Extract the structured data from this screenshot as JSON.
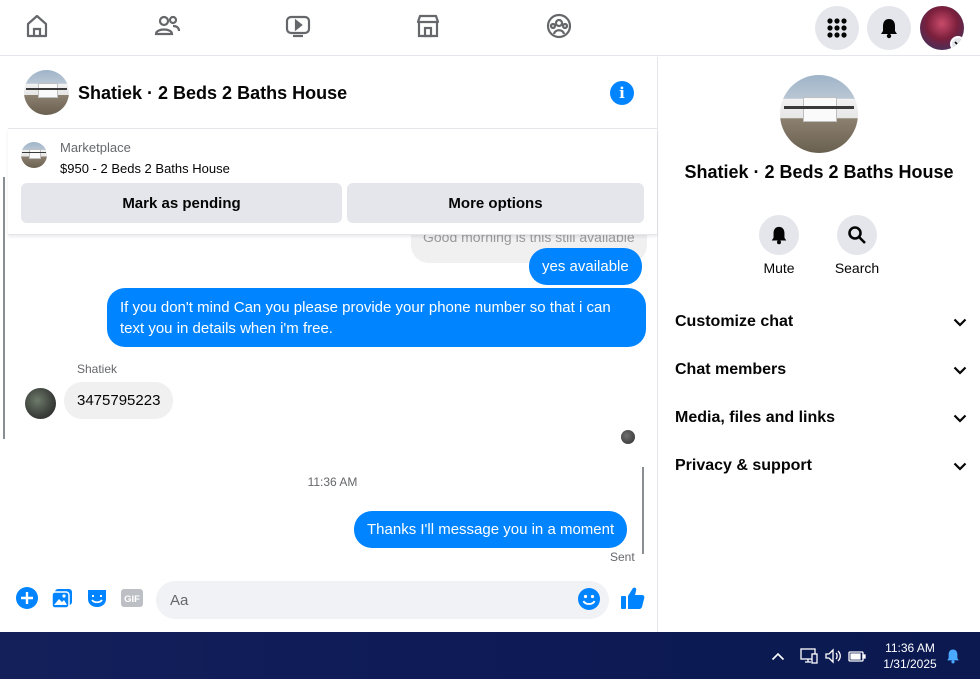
{
  "topnav": {
    "icons": [
      "home-icon",
      "friends-icon",
      "watch-icon",
      "marketplace-icon",
      "groups-icon"
    ],
    "menu_icon": "apps-grid-icon",
    "notifications_icon": "bell-icon"
  },
  "chat": {
    "title": "Shatiek · 2 Beds 2 Baths House",
    "marketplace": {
      "label": "Marketplace",
      "listing": "$950 - 2 Beds 2 Baths House",
      "mark_pending_label": "Mark as pending",
      "more_options_label": "More options"
    },
    "messages": {
      "faded_incoming": "Good morning is this still available",
      "outgoing_1": "yes available",
      "outgoing_2": "If you don't mind Can you please provide your phone number so that i can text you in details when i'm free.",
      "sender_name": "Shatiek",
      "incoming_1": "3475795223",
      "timestamp": "11:36 AM",
      "outgoing_3": "Thanks I'll message you in a moment",
      "sent_status": "Sent"
    },
    "composer": {
      "placeholder": "Aa",
      "gif_label": "GIF"
    }
  },
  "panel": {
    "title": "Shatiek · 2 Beds 2 Baths House",
    "mute_label": "Mute",
    "search_label": "Search",
    "sections": [
      "Customize chat",
      "Chat members",
      "Media, files and links",
      "Privacy & support"
    ]
  },
  "taskbar": {
    "time": "11:36 AM",
    "date": "1/31/2025"
  },
  "colors": {
    "accent": "#0084ff",
    "taskbar": "#0e1b57"
  }
}
